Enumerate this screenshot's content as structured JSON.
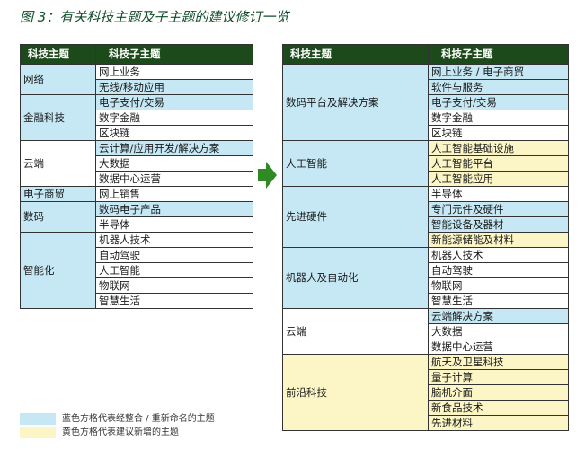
{
  "title": "图 3：有关科技主题及子主题的建议修订一览",
  "colors": {
    "header_bg": "#1d4a1b",
    "blue": "#c6e8f5",
    "yellow": "#fcf6c7",
    "arrow": "#2f8a24"
  },
  "icons": {
    "arrow": "right-arrow-icon"
  },
  "left_table": {
    "col1_header": "科技主题",
    "col2_header": "科技子主题",
    "groups": [
      {
        "name": "网络",
        "color": "blue",
        "subs": [
          {
            "label": "网上业务",
            "color": "white"
          },
          {
            "label": "无线/移动应用",
            "color": "blue"
          }
        ]
      },
      {
        "name": "金融科技",
        "color": "blue",
        "subs": [
          {
            "label": "电子支付/交易",
            "color": "blue"
          },
          {
            "label": "数字金融",
            "color": "white"
          },
          {
            "label": "区块链",
            "color": "white"
          }
        ]
      },
      {
        "name": "云端",
        "color": "white",
        "subs": [
          {
            "label": "云计算/应用开发/解决方案",
            "color": "blue"
          },
          {
            "label": "大数据",
            "color": "white"
          },
          {
            "label": "数据中心运营",
            "color": "white"
          }
        ]
      },
      {
        "name": "电子商贸",
        "color": "blue",
        "subs": [
          {
            "label": "网上销售",
            "color": "white"
          }
        ]
      },
      {
        "name": "数码",
        "color": "blue",
        "subs": [
          {
            "label": "数码电子产品",
            "color": "blue"
          },
          {
            "label": "半导体",
            "color": "white"
          }
        ]
      },
      {
        "name": "智能化",
        "color": "blue",
        "subs": [
          {
            "label": "机器人技术",
            "color": "white"
          },
          {
            "label": "自动驾驶",
            "color": "white"
          },
          {
            "label": "人工智能",
            "color": "white"
          },
          {
            "label": "物联网",
            "color": "white"
          },
          {
            "label": "智慧生活",
            "color": "white"
          }
        ]
      }
    ]
  },
  "right_table": {
    "col1_header": "科技主题",
    "col2_header": "科技子主题",
    "groups": [
      {
        "name": "数码平台及解决方案",
        "color": "blue",
        "subs": [
          {
            "label": "网上业务 / 电子商贸",
            "color": "blue"
          },
          {
            "label": "软件与服务",
            "color": "blue"
          },
          {
            "label": "电子支付/交易",
            "color": "blue"
          },
          {
            "label": "数字金融",
            "color": "white"
          },
          {
            "label": "区块链",
            "color": "white"
          }
        ]
      },
      {
        "name": "人工智能",
        "color": "blue",
        "subs": [
          {
            "label": "人工智能基础设施",
            "color": "yellow"
          },
          {
            "label": "人工智能平台",
            "color": "yellow"
          },
          {
            "label": "人工智能应用",
            "color": "yellow"
          }
        ]
      },
      {
        "name": "先进硬件",
        "color": "blue",
        "subs": [
          {
            "label": "半导体",
            "color": "white"
          },
          {
            "label": "专门元件及硬件",
            "color": "blue"
          },
          {
            "label": "智能设备及器材",
            "color": "blue"
          },
          {
            "label": "新能源储能及材料",
            "color": "yellow"
          }
        ]
      },
      {
        "name": "机器人及自动化",
        "color": "blue",
        "subs": [
          {
            "label": "机器人技术",
            "color": "white"
          },
          {
            "label": "自动驾驶",
            "color": "white"
          },
          {
            "label": "物联网",
            "color": "white"
          },
          {
            "label": "智慧生活",
            "color": "white"
          }
        ]
      },
      {
        "name": "云端",
        "color": "white",
        "subs": [
          {
            "label": "云端解决方案",
            "color": "blue"
          },
          {
            "label": "大数据",
            "color": "white"
          },
          {
            "label": "数据中心运营",
            "color": "white"
          }
        ]
      },
      {
        "name": "前沿科技",
        "color": "yellow",
        "subs": [
          {
            "label": "航天及卫星科技",
            "color": "yellow"
          },
          {
            "label": "量子计算",
            "color": "yellow"
          },
          {
            "label": "脑机介面",
            "color": "yellow"
          },
          {
            "label": "新食品技术",
            "color": "yellow"
          },
          {
            "label": "先进材料",
            "color": "yellow"
          }
        ]
      }
    ]
  },
  "legend": {
    "blue_label": "蓝色方格代表经整合 / 重新命名的主题",
    "yellow_label": "黄色方格代表建议新增的主题"
  }
}
